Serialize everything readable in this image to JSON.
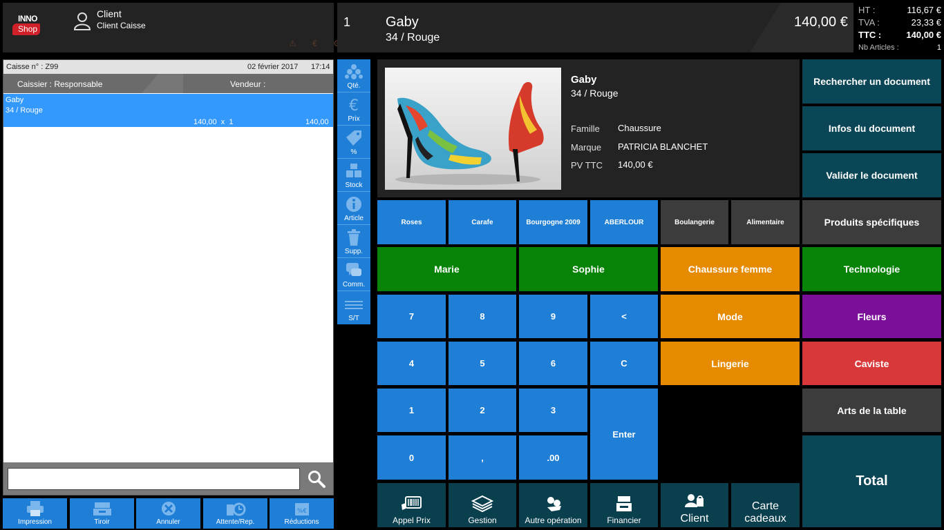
{
  "header": {
    "logo_top": "INNO",
    "logo_bottom": "Shop",
    "client_title": "Client",
    "client_sub": "Client Caisse",
    "status_icons": "⚠ € ⚙"
  },
  "current_line": {
    "number": "1",
    "name": "Gaby",
    "variant": "34 / Rouge",
    "total": "140,00 €"
  },
  "totals": {
    "ht_label": "HT :",
    "ht_value": "116,67 €",
    "tva_label": "TVA :",
    "tva_value": "23,33 €",
    "ttc_label": "TTC :",
    "ttc_value": "140,00 €",
    "nb_label": "Nb Articles :",
    "nb_value": "1"
  },
  "ticket": {
    "caisse": "Caisse n° : Z99",
    "date": "02 février 2017",
    "time": "17:14",
    "cashier": "Caissier : Responsable",
    "seller": "Vendeur :",
    "lines": [
      {
        "name": "Gaby",
        "variant": "34 / Rouge",
        "qty_price": "140,00  x  1",
        "total": "140,00"
      }
    ],
    "scan_value": ""
  },
  "bottom_left": [
    "Impression",
    "Tiroir",
    "Annuler",
    "Attente/Rep.",
    "Réductions"
  ],
  "sidebar": [
    "Qté.",
    "Prix",
    "%",
    "Stock",
    "Article",
    "Supp.",
    "Comm.",
    "S/T"
  ],
  "product": {
    "name": "Gaby",
    "variant": "34 / Rouge",
    "famille_label": "Famille",
    "famille": "Chaussure",
    "marque_label": "Marque",
    "marque": "PATRICIA BLANCHET",
    "pv_label": "PV TTC",
    "pv": "140,00 €"
  },
  "right_actions": [
    "Rechercher un document",
    "Infos du document",
    "Valider le document"
  ],
  "quick_items": [
    "Roses",
    "Carafe",
    "Bourgogne 2009",
    "ABERLOUR",
    "Boulangerie",
    "Alimentaire"
  ],
  "sellers": [
    "Marie",
    "Sophie"
  ],
  "categories": {
    "produits": "Produits spécifiques",
    "chaussure_femme": "Chaussure femme",
    "technologie": "Technologie",
    "mode": "Mode",
    "fleurs": "Fleurs",
    "lingerie": "Lingerie",
    "caviste": "Caviste",
    "arts": "Arts de la table"
  },
  "keypad": {
    "k7": "7",
    "k8": "8",
    "k9": "9",
    "back": "<",
    "k4": "4",
    "k5": "5",
    "k6": "6",
    "clear": "C",
    "k1": "1",
    "k2": "2",
    "k3": "3",
    "enter": "Enter",
    "k0": "0",
    "comma": ",",
    "k00": ".00"
  },
  "bottom_actions": {
    "appel": "Appel Prix",
    "gestion": "Gestion",
    "autre": "Autre opération",
    "financier": "Financier",
    "client": "Client",
    "carte1": "Carte",
    "carte2": "cadeaux",
    "total": "Total"
  },
  "colors": {
    "blue": "#1f7fd6",
    "teal": "#0a3f4e",
    "green": "#078307",
    "orange": "#e68a00",
    "purple": "#7a0f9a",
    "red": "#d9383a",
    "selected": "#3399ff"
  }
}
